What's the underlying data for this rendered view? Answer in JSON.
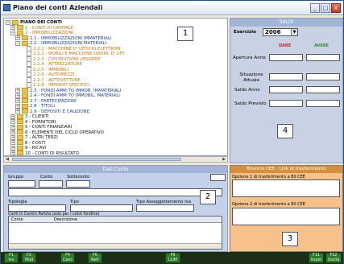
{
  "window": {
    "title": "Piano dei conti Aziendali",
    "buttons": {
      "minimize": "_",
      "maximize": "□",
      "close": "x"
    }
  },
  "tree": {
    "items": [
      {
        "toggle": "−",
        "icon": "folder",
        "label": "PIANO DEI CONTI",
        "style": "root",
        "indent": 0
      },
      {
        "toggle": "+",
        "icon": "folder",
        "label": "1 - CONTI DI CAPITALE",
        "style": "orange",
        "indent": 1
      },
      {
        "toggle": "−",
        "icon": "folder",
        "label": "2 - IMMOBILIZZAZIONI",
        "style": "orange",
        "indent": 1
      },
      {
        "toggle": "+",
        "icon": "folder",
        "label": "2.1 - IMMOBILIZZAZIONI IMMATERIALI",
        "style": "blue",
        "indent": 2
      },
      {
        "toggle": "−",
        "icon": "folder",
        "label": "2.2 - IMMOBILIZZAZIONI MATERIALI",
        "style": "blue",
        "indent": 2
      },
      {
        "toggle": "",
        "icon": "doc",
        "label": "2.2.1 - MACCHINE D' UFFICIO ELETTRON.",
        "style": "orange",
        "indent": 3
      },
      {
        "toggle": "",
        "icon": "doc",
        "label": "2.2.2 - MOBILI E MACCHINE ORDIN. D' UFF.",
        "style": "orange",
        "indent": 3
      },
      {
        "toggle": "",
        "icon": "doc",
        "label": "2.2.3 - COSTRUZIONI LEGGERE",
        "style": "orange",
        "indent": 3
      },
      {
        "toggle": "",
        "icon": "doc",
        "label": "2.2.4 - ATTREZZATURE",
        "style": "orange",
        "indent": 3
      },
      {
        "toggle": "",
        "icon": "doc",
        "label": "2.2.5 - IMMOBILI",
        "style": "orange",
        "indent": 3
      },
      {
        "toggle": "",
        "icon": "doc",
        "label": "2.2.6 - AUTOMEZZI",
        "style": "orange",
        "indent": 3
      },
      {
        "toggle": "",
        "icon": "doc",
        "label": "2.2.7 - AUTOVETTURE",
        "style": "orange",
        "indent": 3
      },
      {
        "toggle": "",
        "icon": "doc",
        "label": "2.2.8 - IMPIANTI SPECIFICI",
        "style": "orange",
        "indent": 3
      },
      {
        "toggle": "+",
        "icon": "folder",
        "label": "2.3 - FONDI AMM.TO IMMOB. IMMATERIALI",
        "style": "blue",
        "indent": 2
      },
      {
        "toggle": "+",
        "icon": "folder",
        "label": "2.4 - FONDI AMM.TO IMMOBIL. MATERIALI",
        "style": "blue",
        "indent": 2
      },
      {
        "toggle": "+",
        "icon": "folder",
        "label": "2.7 - PARTECIPAZIONI",
        "style": "blue",
        "indent": 2
      },
      {
        "toggle": "+",
        "icon": "folder",
        "label": "2.8 - TITOLI",
        "style": "blue",
        "indent": 2
      },
      {
        "toggle": "+",
        "icon": "folder",
        "label": "2.9 - DEPOSITI E CAUZIONE",
        "style": "blue",
        "indent": 2
      },
      {
        "toggle": "+",
        "icon": "folder",
        "label": "3 - CLIENTI",
        "style": "black",
        "indent": 1
      },
      {
        "toggle": "+",
        "icon": "folder",
        "label": "4 - FORNITORI",
        "style": "black",
        "indent": 1
      },
      {
        "toggle": "+",
        "icon": "folder",
        "label": "5 - CONTI FINANZIARI",
        "style": "black",
        "indent": 1
      },
      {
        "toggle": "+",
        "icon": "folder",
        "label": "6 - ELEMENTI DEL CICLO OPERATIVO",
        "style": "black",
        "indent": 1
      },
      {
        "toggle": "+",
        "icon": "folder",
        "label": "7 - ALTRI TERZI",
        "style": "black",
        "indent": 1
      },
      {
        "toggle": "+",
        "icon": "folder",
        "label": "8 - COSTI",
        "style": "black",
        "indent": 1
      },
      {
        "toggle": "+",
        "icon": "folder",
        "label": "9 - RICAVI",
        "style": "black",
        "indent": 1
      },
      {
        "toggle": "+",
        "icon": "folder",
        "label": "10 - CONTI DI RISULTATO",
        "style": "black",
        "indent": 1
      }
    ]
  },
  "badges": {
    "one": "1",
    "two": "2",
    "three": "3",
    "four": "4"
  },
  "saldi": {
    "header": "SALDI",
    "esercizio_label": "Esercizio",
    "esercizio_value": "2006",
    "dare_label": "DARE",
    "avere_label": "AVERE",
    "apertura_label": "Apertura Anno",
    "situazione_label": "Situazione Attuale",
    "saldo_anno_label": "Saldo Anno",
    "saldo_previsto_label": "Saldo Previsto"
  },
  "dati_conto": {
    "header": "Dati Conto",
    "gruppo_label": "Gruppo",
    "conto_label": "Conto",
    "sottoconto_label": "Sottoconto",
    "tipologia_label": "Tipologia",
    "tipo_label": "Tipo",
    "tipo_iva_label": "Tipo Assoggettamento Iva",
    "contropartita_label": "Conti in Contro Partita (solo per i conti fondine)",
    "grid_col_conto": "Conto",
    "grid_col_descrizione": "Descrizione"
  },
  "cee": {
    "header": "Bilancio CEE - Link di trasferimento",
    "opzione1_label": "Opzione 1 di trasferimento a Bil CEE",
    "opzione2_label": "Opzione 2 di trasferimento a Bil CEE"
  },
  "fkeys": [
    {
      "key": "F1",
      "label": "Ins"
    },
    {
      "key": "F2",
      "label": "Mod"
    },
    {
      "key": "F4",
      "label": "Canc"
    },
    {
      "key": "F6",
      "label": "Refr"
    },
    {
      "key": "F9",
      "label": "LLIM"
    },
    {
      "key": "F11",
      "label": "Impor"
    },
    {
      "key": "F12",
      "label": "Uscita"
    }
  ]
}
